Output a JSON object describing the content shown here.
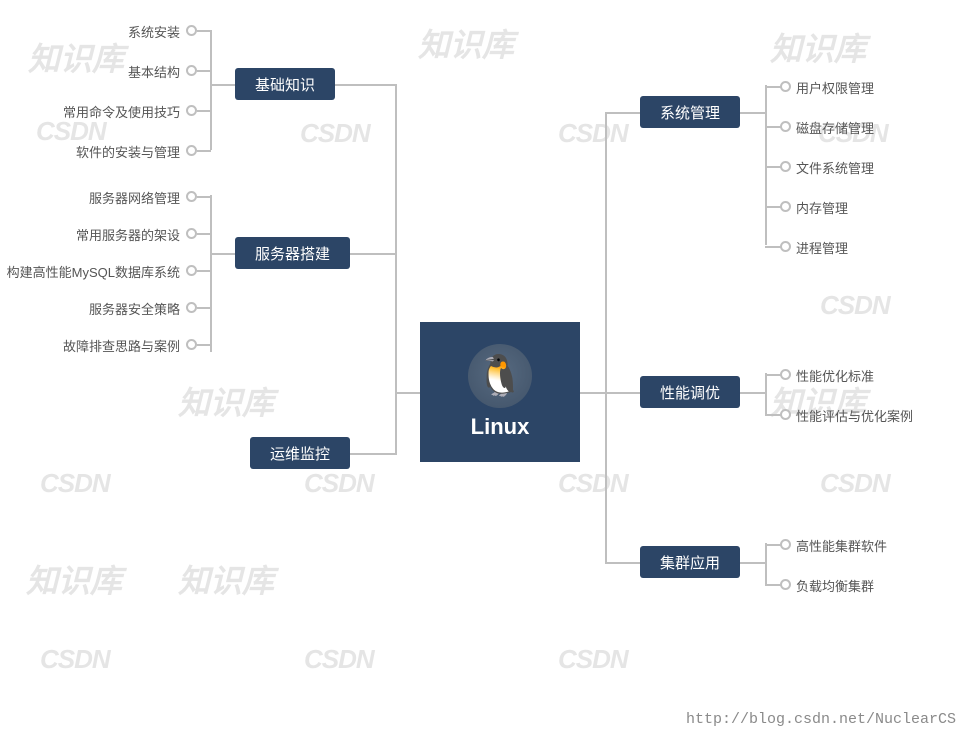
{
  "center": {
    "title": "Linux",
    "icon_name": "tux-penguin"
  },
  "categories_left": [
    {
      "label": "基础知识",
      "leaves": [
        "系统安装",
        "基本结构",
        "常用命令及使用技巧",
        "软件的安装与管理"
      ]
    },
    {
      "label": "服务器搭建",
      "leaves": [
        "服务器网络管理",
        "常用服务器的架设",
        "构建高性能MySQL数据库系统",
        "服务器安全策略",
        "故障排查思路与案例"
      ]
    },
    {
      "label": "运维监控",
      "leaves": []
    }
  ],
  "categories_right": [
    {
      "label": "系统管理",
      "leaves": [
        "用户权限管理",
        "磁盘存储管理",
        "文件系统管理",
        "内存管理",
        "进程管理"
      ]
    },
    {
      "label": "性能调优",
      "leaves": [
        "性能优化标准",
        "性能评估与优化案例"
      ]
    },
    {
      "label": "集群应用",
      "leaves": [
        "高性能集群软件",
        "负载均衡集群"
      ]
    }
  ],
  "footer_url": "http://blog.csdn.net/NuclearCS",
  "watermarks": {
    "zh": "知识库",
    "en": "CSDN"
  }
}
